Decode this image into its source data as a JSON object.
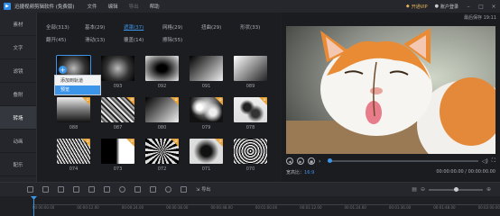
{
  "window": {
    "app_title": "迅捷视频剪辑软件 (免费版)",
    "menu": [
      "文件",
      "编辑",
      "导出",
      "帮助"
    ],
    "vip_label": "开通VIP",
    "login_label": "账户登录"
  },
  "leftnav": {
    "items": [
      "素材",
      "文字",
      "滤镜",
      "叠附",
      "转场",
      "动画",
      "配乐"
    ],
    "active_index": 4
  },
  "filters": {
    "categories": [
      "全部(313)",
      "基本(29)",
      "遮罩(37)",
      "网格(29)",
      "扭曲(29)",
      "形状(33)",
      "翻开(45)",
      "滑动(13)",
      "覆盖(14)",
      "擦除(55)"
    ],
    "active_category": "遮罩(37)",
    "tiles": [
      {
        "label": "",
        "premium": false
      },
      {
        "label": "093",
        "premium": false
      },
      {
        "label": "092",
        "premium": false
      },
      {
        "label": "091",
        "premium": false
      },
      {
        "label": "089",
        "premium": false
      },
      {
        "label": "088",
        "premium": true
      },
      {
        "label": "087",
        "premium": true
      },
      {
        "label": "080",
        "premium": true
      },
      {
        "label": "079",
        "premium": true
      },
      {
        "label": "078",
        "premium": true
      },
      {
        "label": "074",
        "premium": true
      },
      {
        "label": "073",
        "premium": true
      },
      {
        "label": "072",
        "premium": true
      },
      {
        "label": "071",
        "premium": true
      },
      {
        "label": "070",
        "premium": false
      }
    ],
    "context_menu": [
      "添加到轨道",
      "预览"
    ]
  },
  "preview": {
    "save_time": "最后保存 19:11",
    "ratio_label": "宽高比：",
    "ratio_value": "16:9",
    "time_display": "00:00:00.00 / 00:00:00.00"
  },
  "toolbar": {
    "export_label": "导出"
  },
  "timeline": {
    "ticks": [
      "00:00:00.00",
      "00:00:12.00",
      "00:00:24.00",
      "00:00:36.00",
      "00:00:48.00",
      "00:01:00.00",
      "00:01:12.00",
      "00:01:24.00",
      "00:01:36.00",
      "00:01:48.00",
      "00:02:00.00"
    ]
  },
  "colors": {
    "accent": "#3d95ea",
    "premium": "#e8a33a",
    "vip": "#e7b45a"
  }
}
